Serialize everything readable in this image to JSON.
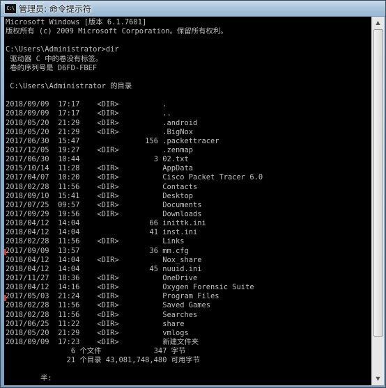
{
  "window": {
    "icon_text": "C:\\",
    "title": "管理员: 命令提示符"
  },
  "console_lines": [
    "Microsoft Windows [版本 6.1.7601]",
    "版权所有 (c) 2009 Microsoft Corporation。保留所有权利。",
    "",
    "C:\\Users\\Administrator>dir",
    " 驱动器 C 中的卷没有标签。",
    " 卷的序列号是 D6FD-FBEF",
    "",
    " C:\\Users\\Administrator 的目录",
    "",
    "2018/09/09  17:17    <DIR>          .",
    "2018/09/09  17:17    <DIR>          ..",
    "2018/05/20  21:29    <DIR>          .android",
    "2018/05/20  21:29    <DIR>          .BigNox",
    "2017/06/30  15:47               156 .packettracer",
    "2017/12/05  19:27    <DIR>          .zenmap",
    "2017/06/30  10:44                 3 02.txt",
    "2015/10/14  11:28    <DIR>          AppData",
    "2017/04/07  10:20    <DIR>          Cisco Packet Tracer 6.0",
    "2018/02/28  11:56    <DIR>          Contacts",
    "2018/09/10  15:41    <DIR>          Desktop",
    "2017/07/25  09:57    <DIR>          Documents",
    "2017/09/29  19:56    <DIR>          Downloads",
    "2018/04/12  14:04                66 inittk.ini",
    "2018/04/12  14:04                41 inst.ini",
    "2018/02/28  11:56    <DIR>          Links",
    "2017/09/09  13:57                36 mm.cfg",
    "2018/04/12  14:04    <DIR>          Nox_share",
    "2018/04/12  14:04                45 nuuid.ini",
    "2017/11/27  18:36    <DIR>          OneDrive",
    "2018/04/12  14:16    <DIR>          Oxygen Forensic Suite",
    "2017/05/03  21:24    <DIR>          Program Files",
    "2018/02/28  11:56    <DIR>          Saved Games",
    "2018/02/28  11:56    <DIR>          Searches",
    "2017/06/25  11:22    <DIR>          share",
    "2018/05/20  21:29    <DIR>          vmlogs",
    "2018/09/09  17:23    <DIR>          新建文件夹",
    "               6 个文件            347 字节",
    "              21 个目录 43,081,748,480 可用字节",
    "",
    "        半:"
  ]
}
